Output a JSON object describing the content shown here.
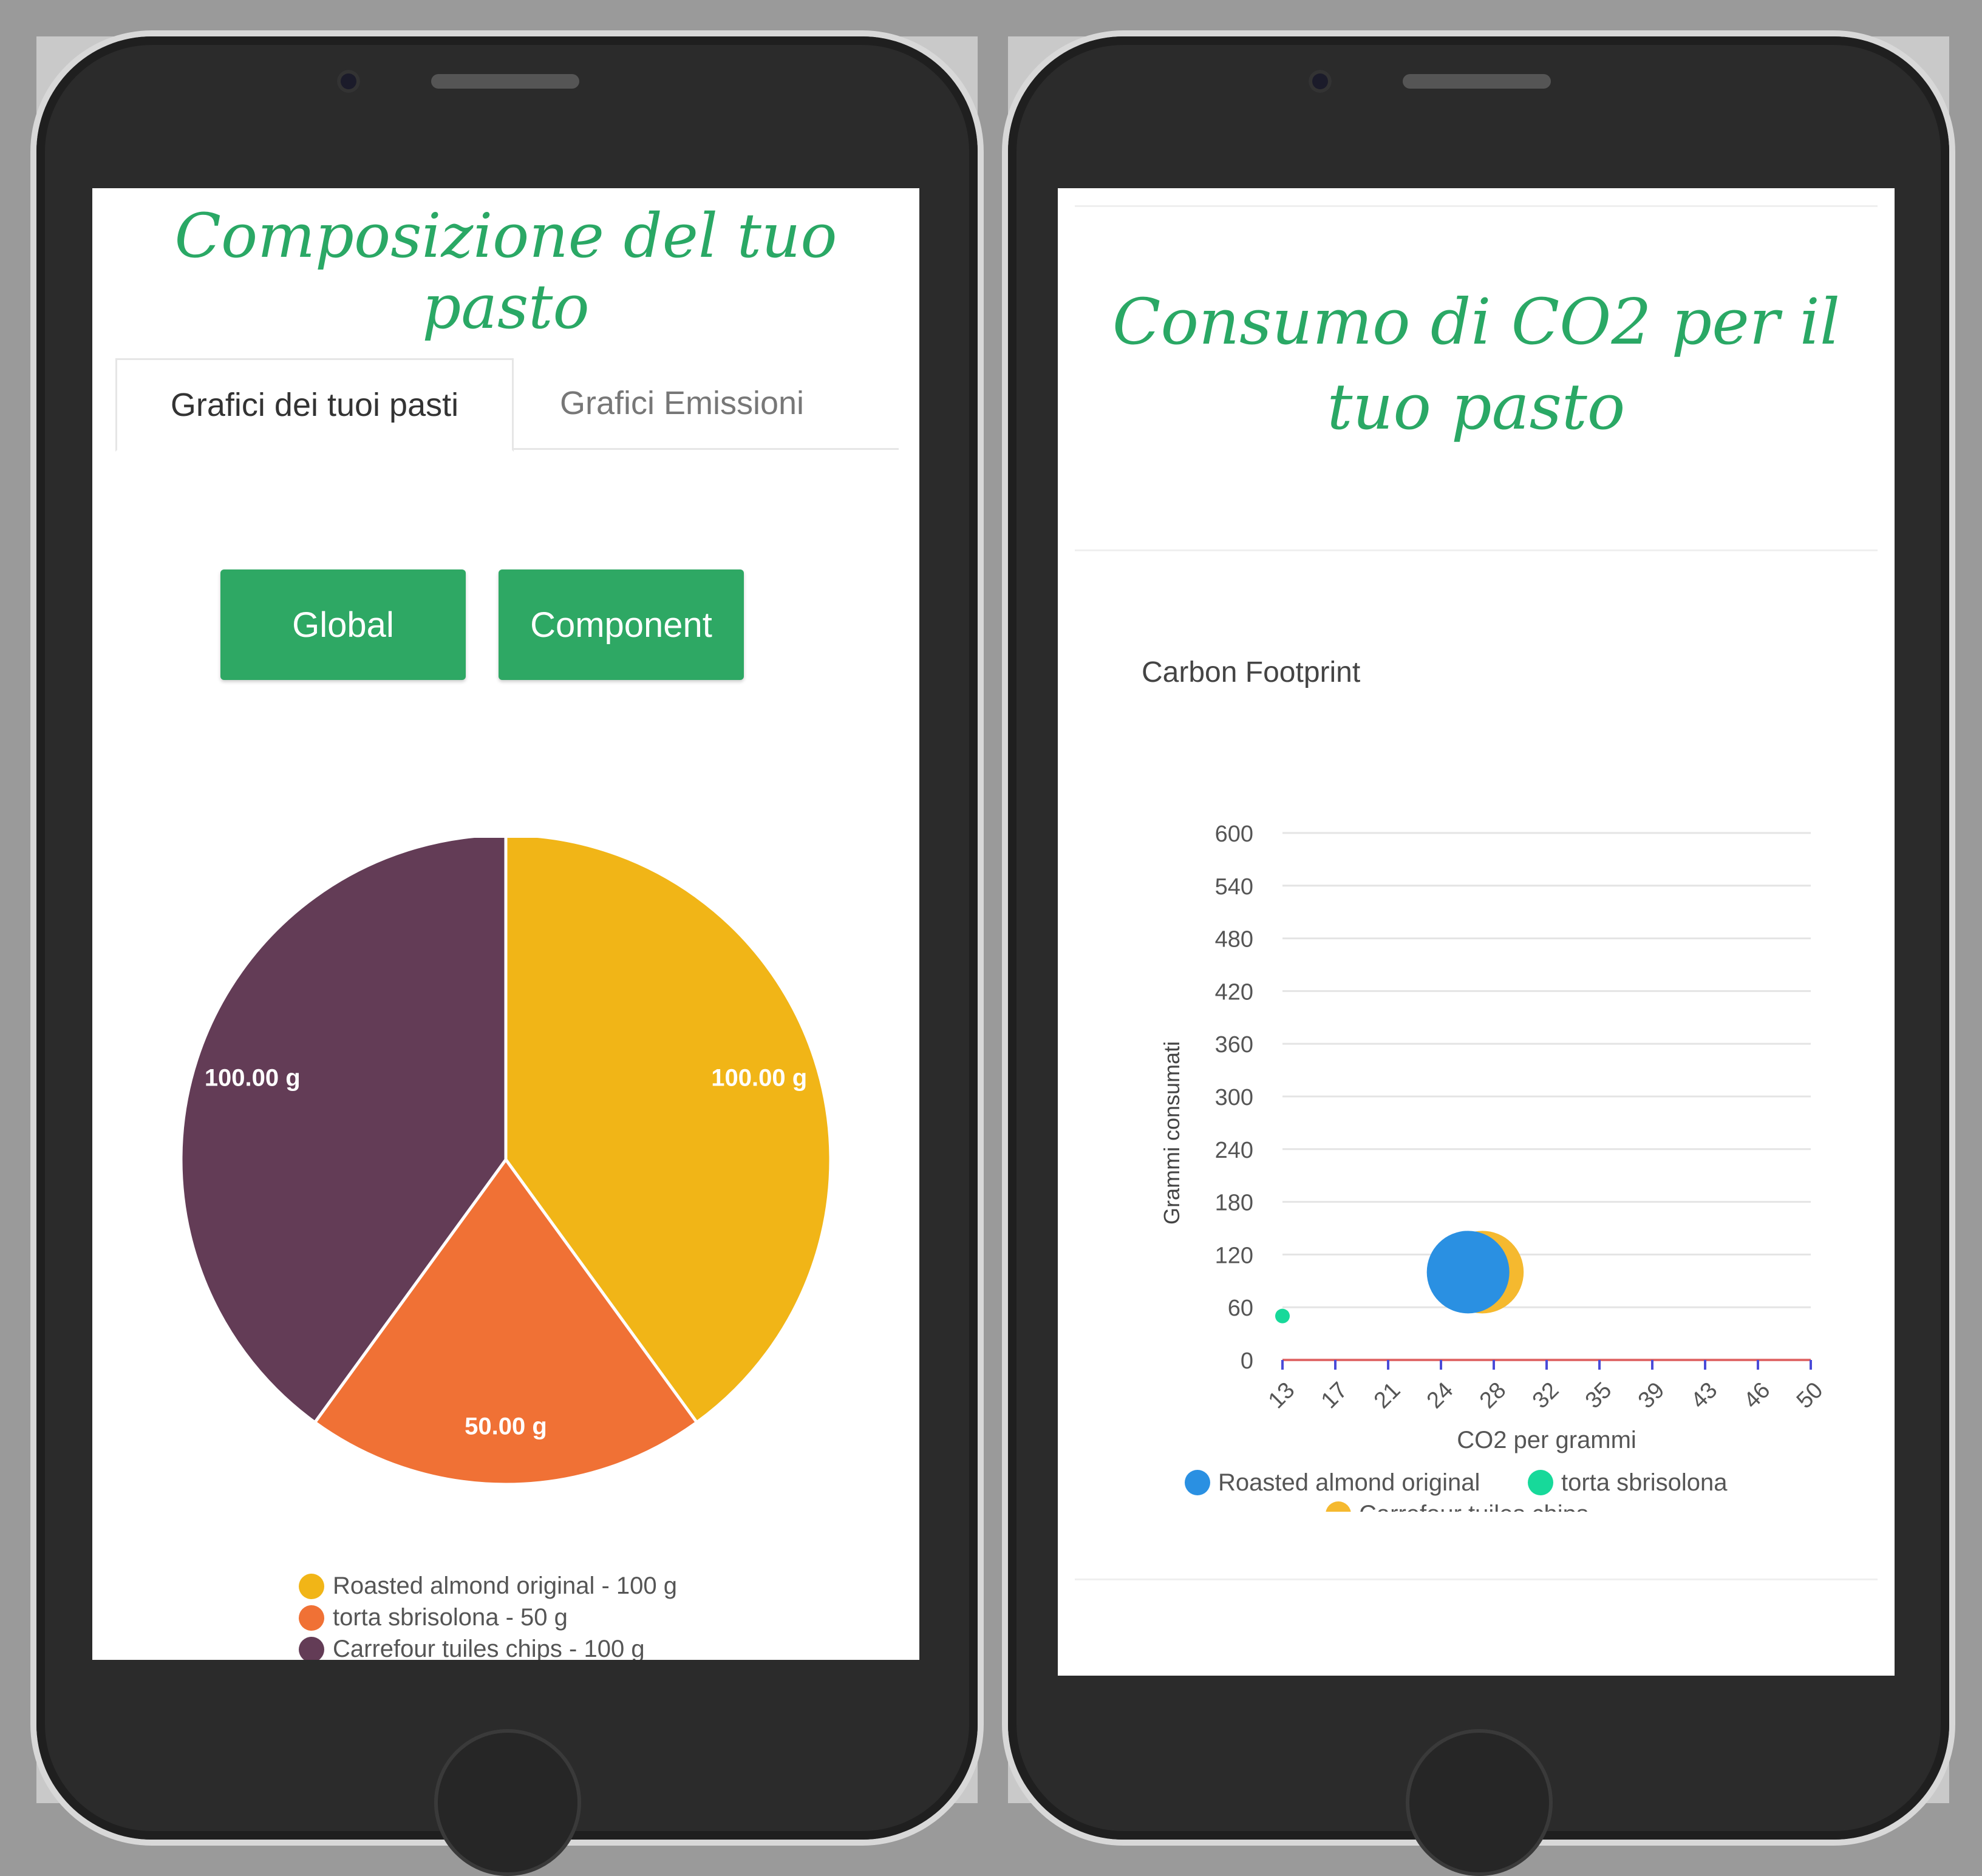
{
  "left_screen": {
    "title": "Composizione del tuo pasto",
    "tabs": [
      {
        "label": "Grafici dei tuoi pasti",
        "active": true
      },
      {
        "label": "Grafici Emissioni",
        "active": false
      }
    ],
    "buttons": {
      "global_label": "Global",
      "component_label": "Component"
    },
    "accent_color": "#2ea864"
  },
  "right_screen": {
    "title": "Consumo di CO2 per il tuo pasto",
    "chart_title": "Carbon Footprint"
  },
  "chart_data": [
    {
      "type": "pie",
      "slices": [
        {
          "label": "Roasted almond original - 100 g",
          "value": 100,
          "data_label": "100.00 g",
          "color": "#f1b517"
        },
        {
          "label": "torta sbrisolona - 50 g",
          "value": 50,
          "data_label": "50.00 g",
          "color": "#f07135"
        },
        {
          "label": "Carrefour tuiles chips - 100 g",
          "value": 100,
          "data_label": "100.00 g",
          "color": "#633c56"
        }
      ]
    },
    {
      "type": "scatter",
      "title": "Carbon Footprint",
      "xlabel": "CO2 per grammi",
      "ylabel": "Grammi consumati",
      "x_ticks": [
        "13",
        "17",
        "21",
        "24",
        "28",
        "32",
        "35",
        "39",
        "43",
        "46",
        "50"
      ],
      "xlim": [
        13,
        50
      ],
      "y_ticks": [
        "600",
        "540",
        "480",
        "420",
        "360",
        "300",
        "240",
        "180",
        "120",
        "60",
        "0"
      ],
      "ylim": [
        0,
        600
      ],
      "grid": true,
      "legend_position": "bottom",
      "series": [
        {
          "name": "Roasted almond original",
          "color": "#2a90e2",
          "points": [
            {
              "x": 26,
              "y": 100,
              "r": 100
            }
          ]
        },
        {
          "name": "torta sbrisolona",
          "color": "#17d99a",
          "points": [
            {
              "x": 13,
              "y": 50,
              "r": 50
            }
          ]
        },
        {
          "name": "Carrefour tuiles chips",
          "color": "#f5b92f",
          "points": [
            {
              "x": 27,
              "y": 100,
              "r": 100
            }
          ]
        }
      ]
    }
  ]
}
